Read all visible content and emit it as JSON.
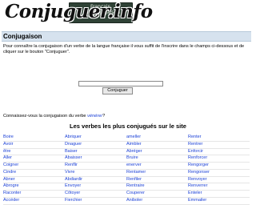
{
  "header": {
    "logo_text": "Conjuguer.info",
    "chalkboard_lines": [
      "Français",
      "Conjugaison"
    ]
  },
  "section_title": "Conjugaison",
  "intro_text": "Pour connaître la conjugaison d'un verbe de la langue française il vous suffit de l'inscrire dans le champs ci-dessous et de cliquer sur le bouton \"Conjuguer\".",
  "form": {
    "input_value": "",
    "input_placeholder": "",
    "button_label": "Conjuguer"
  },
  "known_prefix": "Connaissez-vous la conjugaison du verbe",
  "known_verb": "vénérer",
  "known_suffix": "?",
  "popular_title": "Les verbes les plus conjugués sur le site",
  "verb_rows": [
    [
      "Boire",
      "Abriquer",
      "ameller",
      "Renter"
    ],
    [
      "Avoir",
      "Dnaguer",
      "Aimbler",
      "Rentrer"
    ],
    [
      "être",
      "Baiser",
      "Abréger",
      "Enforcir"
    ],
    [
      "Aller",
      "Abaisser",
      "Bruire",
      "Renforcer"
    ],
    [
      "Coigner",
      "Renflir",
      "enerver",
      "Rengorger"
    ],
    [
      "Cindre",
      "Vivre",
      "Rentamer",
      "Rengonser"
    ],
    [
      "Abner",
      "Abdiardir",
      "Renfiler",
      "Renvoyer"
    ],
    [
      "Abrogre",
      "Envoyer",
      "Rentraire",
      "Renverrer"
    ],
    [
      "Raconter",
      "Côtoyer",
      "Couperer",
      "Enteler"
    ],
    [
      "Accéder",
      "Fierchier",
      "Aniboler",
      "Emmailer"
    ]
  ],
  "colors": {
    "link": "#1a3fd6",
    "title_bar": "#d6e2ee",
    "chalkboard": "#2f4236"
  }
}
